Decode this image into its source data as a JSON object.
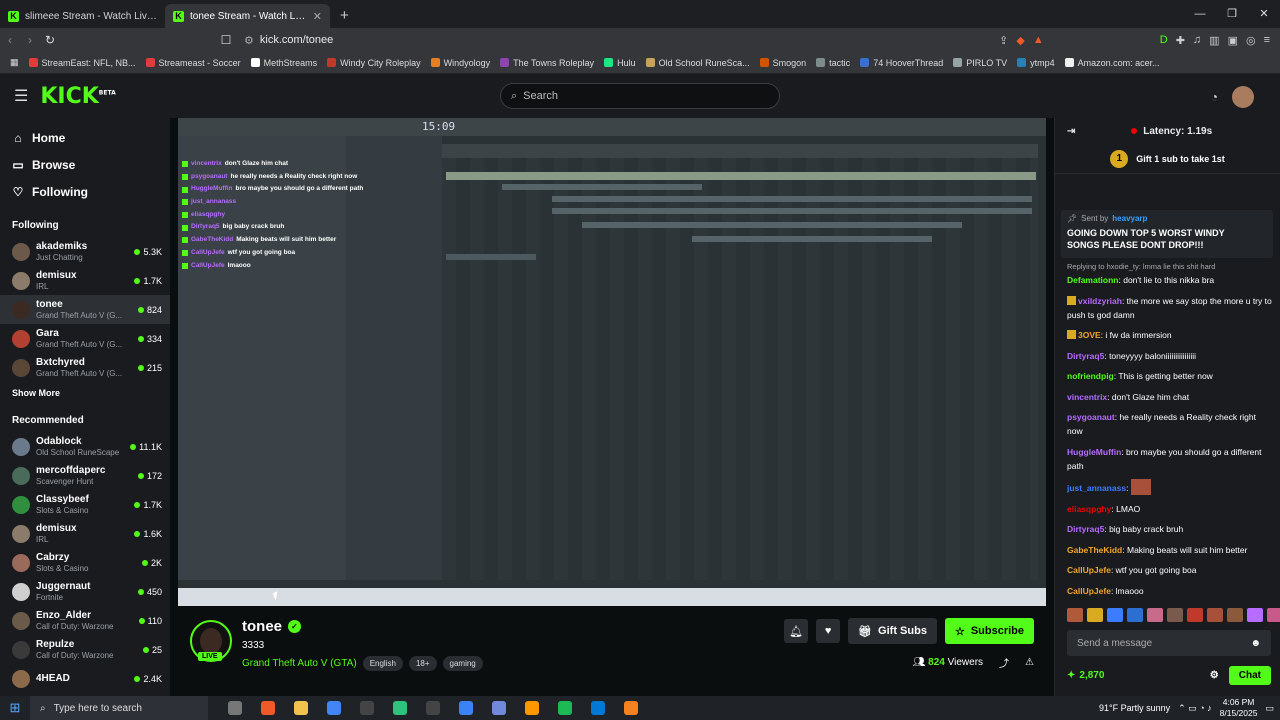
{
  "browser": {
    "tabs": [
      {
        "title": "slimeee Stream - Watch Live on Kick",
        "active": false
      },
      {
        "title": "tonee Stream - Watch Live on Kick",
        "active": true
      }
    ],
    "url": "kick.com/tonee",
    "bookmarks": [
      {
        "label": "StreamEast: NFL, NB...",
        "color": "#e23b3b"
      },
      {
        "label": "Streameast - Soccer",
        "color": "#e23b3b"
      },
      {
        "label": "MethStreams",
        "color": "#ffffff"
      },
      {
        "label": "Windy City Roleplay",
        "color": "#c0392b"
      },
      {
        "label": "Windyology",
        "color": "#e67e22"
      },
      {
        "label": "The Towns Roleplay",
        "color": "#8e44ad"
      },
      {
        "label": "Hulu",
        "color": "#1ce783"
      },
      {
        "label": "Old School RuneSca...",
        "color": "#c8a25a"
      },
      {
        "label": "Smogon",
        "color": "#d35400"
      },
      {
        "label": "tactic",
        "color": "#7f8c8d"
      },
      {
        "label": "74 HooverThread",
        "color": "#3b6ed1"
      },
      {
        "label": "PIRLO TV",
        "color": "#95a5a6"
      },
      {
        "label": "ytmp4",
        "color": "#2980b9"
      },
      {
        "label": "Amazon.com: acer...",
        "color": "#f0f0f0"
      }
    ]
  },
  "header": {
    "logo": "KICK",
    "logo_beta": "BETA",
    "search_placeholder": "Search"
  },
  "sidebar": {
    "nav": [
      {
        "label": "Home",
        "icon": "home-icon"
      },
      {
        "label": "Browse",
        "icon": "browse-icon"
      },
      {
        "label": "Following",
        "icon": "heart-icon"
      }
    ],
    "following_title": "Following",
    "following": [
      {
        "name": "akademiks",
        "category": "Just Chatting",
        "viewers": "5.3K",
        "color": "#6b5a4a",
        "active": false
      },
      {
        "name": "demisux",
        "category": "IRL",
        "viewers": "1.7K",
        "color": "#8a7b6a",
        "active": false
      },
      {
        "name": "tonee",
        "category": "Grand Theft Auto V (G...",
        "viewers": "824",
        "color": "#3b2a22",
        "active": true
      },
      {
        "name": "Gara",
        "category": "Grand Theft Auto V (G...",
        "viewers": "334",
        "color": "#b04030",
        "active": false
      },
      {
        "name": "Bxtchyred",
        "category": "Grand Theft Auto V (G...",
        "viewers": "215",
        "color": "#5a4636",
        "active": false
      }
    ],
    "show_more": "Show More",
    "recommended_title": "Recommended",
    "recommended": [
      {
        "name": "Odablock",
        "category": "Old School RuneScape",
        "viewers": "11.1K",
        "color": "#6a7a8a"
      },
      {
        "name": "mercoffdaperc",
        "category": "Scavenger Hunt",
        "viewers": "172",
        "color": "#4a6a5a"
      },
      {
        "name": "Classybeef",
        "category": "Slots & Casino",
        "viewers": "1.7K",
        "color": "#2f8f3f"
      },
      {
        "name": "demisux",
        "category": "IRL",
        "viewers": "1.6K",
        "color": "#8a7b6a"
      },
      {
        "name": "Cabrzy",
        "category": "Slots & Casino",
        "viewers": "2K",
        "color": "#9a6a5a"
      },
      {
        "name": "Juggernaut",
        "category": "Fortnite",
        "viewers": "450",
        "color": "#cfcfcf"
      },
      {
        "name": "Enzo_Alder",
        "category": "Call of Duty: Warzone",
        "viewers": "110",
        "color": "#6a5a4a"
      },
      {
        "name": "Repulze",
        "category": "Call of Duty: Warzone",
        "viewers": "25",
        "color": "#3a3a3a"
      },
      {
        "name": "4HEAD",
        "category": "",
        "viewers": "2.4K",
        "color": "#8a6a4a"
      }
    ]
  },
  "video": {
    "clock": "15:09",
    "chat_overlay": [
      {
        "user": "vincentrix",
        "text": "don't Glaze him chat"
      },
      {
        "user": "psygoanaut",
        "text": "he really needs a Reality check right now"
      },
      {
        "user": "HuggleMuffin",
        "text": "bro maybe you should go a different path"
      },
      {
        "user": "just_annanass",
        "text": ""
      },
      {
        "user": "eliasqpghy",
        "text": ""
      },
      {
        "user": "Dirtyraq5",
        "text": "big baby crack bruh"
      },
      {
        "user": "GabeTheKidd",
        "text": "Making beats will suit him better"
      },
      {
        "user": "CallUpJefe",
        "text": "wtf you got going boa"
      },
      {
        "user": "CallUpJefe",
        "text": "lmaooo"
      }
    ]
  },
  "stream": {
    "name": "tonee",
    "title": "3333",
    "live": "LIVE",
    "category": "Grand Theft Auto V (GTA)",
    "tags": [
      "English",
      "18+",
      "gaming"
    ],
    "gift_subs": "Gift Subs",
    "subscribe": "Subscribe",
    "viewers": "824",
    "viewers_label": "Viewers"
  },
  "chat": {
    "latency": "Latency: 1.19s",
    "gift_banner": "Gift 1 sub to take 1st",
    "gift_badge": "1",
    "pinned_sent_by": "Sent by",
    "pinned_user": "heavyarp",
    "pinned_message": "GOING DOWN TOP 5 WORST WINDY SONGS PLEASE DONT DROP!!!",
    "reply_line": "Replying to hxodie_ty: lmma lie this shit hard",
    "messages": [
      {
        "user": "Defamationn",
        "text": "don't lie to this nikka bra",
        "color": "#53fc18",
        "badge": false,
        "emote": false
      },
      {
        "user": "vxildzyriah",
        "text": "the more we say stop the more u try to push ts god damn",
        "color": "#b66cff",
        "badge": true,
        "emote": false
      },
      {
        "user": "3OVE",
        "text": "i fw da immersion",
        "color": "#f2a52b",
        "badge": true,
        "emote": false
      },
      {
        "user": "Dirtyraq5",
        "text": "toneyyyy baloniiiiiiiiiiiiiiii",
        "color": "#b66cff",
        "badge": false,
        "emote": false
      },
      {
        "user": "nofriendpig",
        "text": "This is getting better now",
        "color": "#53fc18",
        "badge": false,
        "emote": false
      },
      {
        "user": "vincentrix",
        "text": "don't Glaze him chat",
        "color": "#b66cff",
        "badge": false,
        "emote": false
      },
      {
        "user": "psygoanaut",
        "text": "he really needs a Reality check right now",
        "color": "#b66cff",
        "badge": false,
        "emote": false
      },
      {
        "user": "HuggleMuffin",
        "text": "bro maybe you should go a different path",
        "color": "#b66cff",
        "badge": false,
        "emote": false
      },
      {
        "user": "just_annanass",
        "text": "",
        "color": "#3c7dff",
        "badge": false,
        "emote": true
      },
      {
        "user": "eliasqpghy",
        "text": "LMAO",
        "color": "#eb0400",
        "badge": false,
        "emote": false
      },
      {
        "user": "Dirtyraq5",
        "text": "big baby crack bruh",
        "color": "#b66cff",
        "badge": false,
        "emote": false
      },
      {
        "user": "GabeTheKidd",
        "text": "Making beats will suit him better",
        "color": "#f2a52b",
        "badge": false,
        "emote": false
      },
      {
        "user": "CallUpJefe",
        "text": "wtf you got going boa",
        "color": "#f2a52b",
        "badge": false,
        "emote": false
      },
      {
        "user": "CallUpJefe",
        "text": "lmaooo",
        "color": "#f2a52b",
        "badge": false,
        "emote": false
      }
    ],
    "input_placeholder": "Send a message",
    "points": "2,870",
    "chat_button": "Chat"
  },
  "taskbar": {
    "search_placeholder": "Type here to search",
    "weather": "91°F  Partly sunny",
    "time": "4:06 PM",
    "date": "8/15/2025"
  }
}
